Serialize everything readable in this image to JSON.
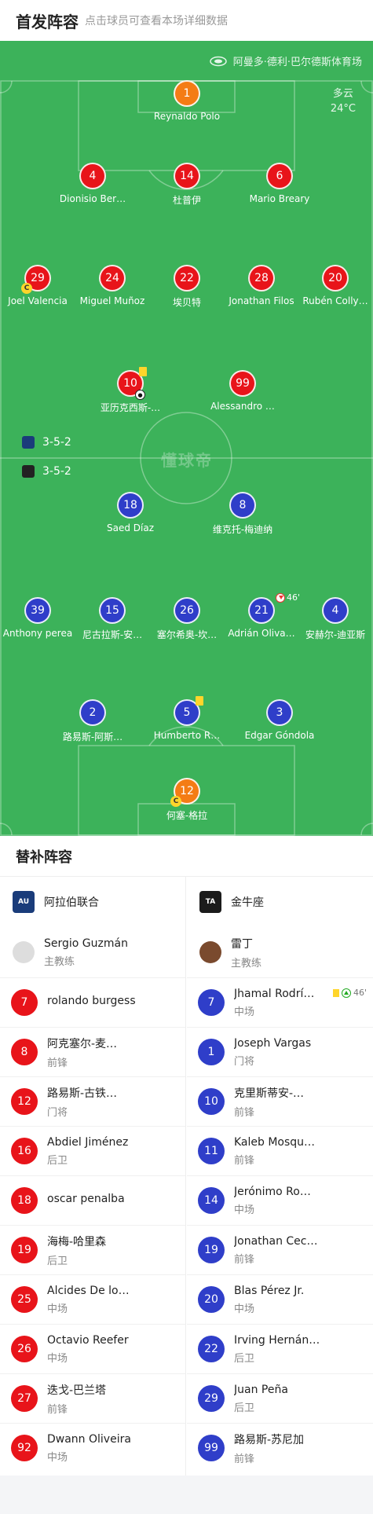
{
  "header": {
    "title": "首发阵容",
    "subtitle": "点击球员可查看本场详细数据"
  },
  "pitch": {
    "venue": "阿曼多·德利·巴尔德斯体育场",
    "weather": "多云",
    "temperature": "24°C",
    "watermark": "懂球帝",
    "home_formation": "3-5-2",
    "away_formation": "3-5-2",
    "home_players": [
      {
        "number": "1",
        "name": "Reynaldo Polo",
        "color": "orange"
      },
      {
        "number": "4",
        "name": "Dionisio Ber…",
        "color": "red"
      },
      {
        "number": "14",
        "name": "杜普伊",
        "color": "red"
      },
      {
        "number": "6",
        "name": "Mario Breary",
        "color": "red"
      },
      {
        "number": "29",
        "name": "Joel Valencia",
        "color": "red",
        "captain": true
      },
      {
        "number": "24",
        "name": "Miguel Muñoz",
        "color": "red"
      },
      {
        "number": "22",
        "name": "埃贝特",
        "color": "red"
      },
      {
        "number": "28",
        "name": "Jonathan Filos",
        "color": "red"
      },
      {
        "number": "20",
        "name": "Rubén Colly…",
        "color": "red"
      },
      {
        "number": "10",
        "name": "亚历克西斯-…",
        "color": "red",
        "yellow": true,
        "goal": true
      },
      {
        "number": "99",
        "name": "Alessandro …",
        "color": "red"
      }
    ],
    "away_players": [
      {
        "number": "18",
        "name": "Saed Díaz",
        "color": "blue"
      },
      {
        "number": "8",
        "name": "维克托-梅迪纳",
        "color": "blue"
      },
      {
        "number": "39",
        "name": "Anthony perea",
        "color": "blue"
      },
      {
        "number": "15",
        "name": "尼古拉斯-安…",
        "color": "blue"
      },
      {
        "number": "26",
        "name": "塞尔希奥-坎…",
        "color": "blue"
      },
      {
        "number": "21",
        "name": "Adrián Oliva…",
        "color": "blue",
        "sub_off": "46'"
      },
      {
        "number": "4",
        "name": "安赫尔-迪亚斯",
        "color": "blue"
      },
      {
        "number": "2",
        "name": "路易斯-阿斯…",
        "color": "blue"
      },
      {
        "number": "5",
        "name": "Humberto R…",
        "color": "blue",
        "yellow": true
      },
      {
        "number": "3",
        "name": "Edgar Góndola",
        "color": "blue"
      },
      {
        "number": "12",
        "name": "何塞-格拉",
        "color": "orange",
        "captain": true
      }
    ]
  },
  "subs": {
    "title": "替补阵容",
    "home": {
      "team": "阿拉伯联合",
      "coach": {
        "name": "Sergio Guzmán",
        "role": "主教练"
      },
      "players": [
        {
          "number": "7",
          "name": "rolando burgess",
          "pos": ""
        },
        {
          "number": "8",
          "name": "阿克塞尔-麦…",
          "pos": "前锋"
        },
        {
          "number": "12",
          "name": "路易斯-古铁…",
          "pos": "门将"
        },
        {
          "number": "16",
          "name": "Abdiel Jiménez",
          "pos": "后卫"
        },
        {
          "number": "18",
          "name": "oscar penalba",
          "pos": ""
        },
        {
          "number": "19",
          "name": "海梅-哈里森",
          "pos": "后卫"
        },
        {
          "number": "25",
          "name": "Alcides De lo…",
          "pos": "中场"
        },
        {
          "number": "26",
          "name": "Octavio Reefer",
          "pos": "中场"
        },
        {
          "number": "27",
          "name": "迭戈-巴兰塔",
          "pos": "前锋"
        },
        {
          "number": "92",
          "name": "Dwann Oliveira",
          "pos": "中场"
        }
      ]
    },
    "away": {
      "team": "金牛座",
      "coach": {
        "name": "雷丁",
        "role": "主教练"
      },
      "players": [
        {
          "number": "7",
          "name": "Jhamal Rodrí…",
          "pos": "中场",
          "yellow": true,
          "sub_on": "46'"
        },
        {
          "number": "1",
          "name": "Joseph Vargas",
          "pos": "门将"
        },
        {
          "number": "10",
          "name": "克里斯蒂安-…",
          "pos": "前锋"
        },
        {
          "number": "11",
          "name": "Kaleb Mosqu…",
          "pos": "前锋"
        },
        {
          "number": "14",
          "name": "Jerónimo Ro…",
          "pos": "中场"
        },
        {
          "number": "19",
          "name": "Jonathan Cec…",
          "pos": "前锋"
        },
        {
          "number": "20",
          "name": "Blas Pérez Jr.",
          "pos": "中场"
        },
        {
          "number": "22",
          "name": "Irving Hernán…",
          "pos": "后卫"
        },
        {
          "number": "29",
          "name": "Juan Peña",
          "pos": "后卫"
        },
        {
          "number": "99",
          "name": "路易斯-苏尼加",
          "pos": "前锋"
        }
      ]
    }
  },
  "colors": {
    "pitch": "#3cb25a",
    "home": "#e8141a",
    "away": "#2f3ec9",
    "keeper": "#f47c15",
    "yellow_card": "#ffd52b"
  }
}
